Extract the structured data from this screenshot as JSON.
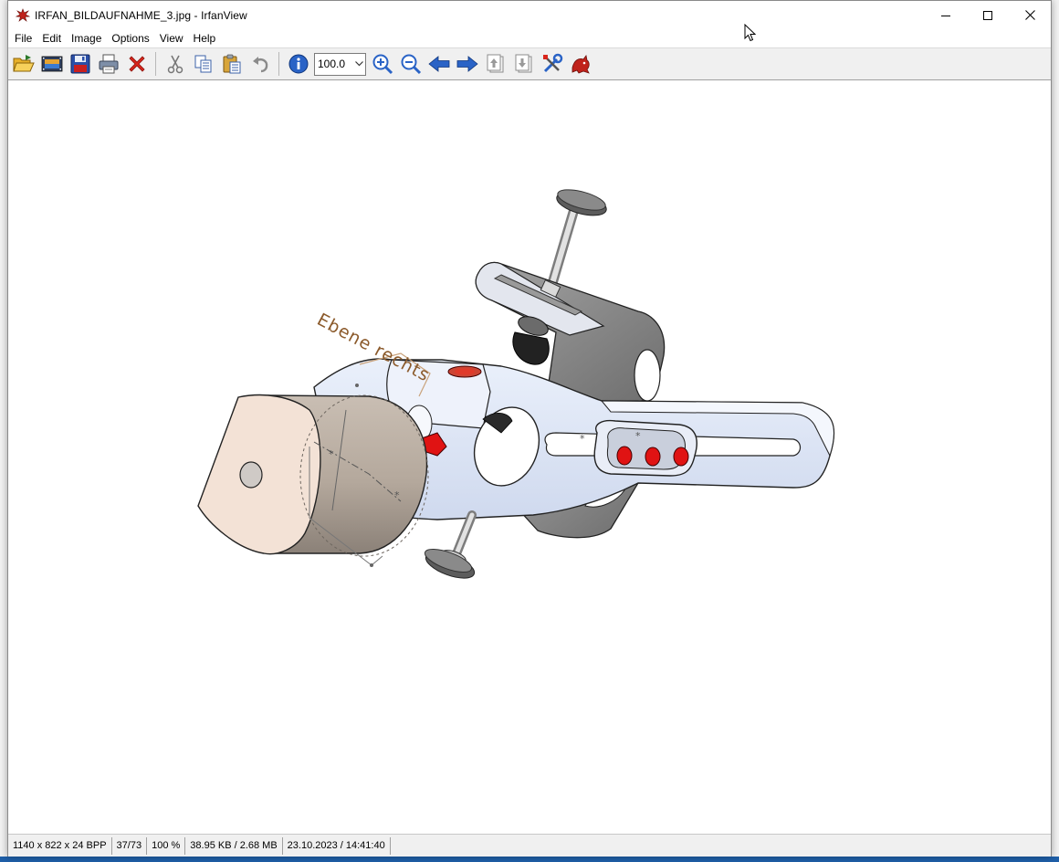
{
  "window": {
    "title": "IRFAN_BILDAUFNAHME_3.jpg - IrfanView"
  },
  "menu": [
    "File",
    "Edit",
    "Image",
    "Options",
    "View",
    "Help"
  ],
  "toolbar": {
    "zoom_value": "100.0"
  },
  "canvas": {
    "annotation_label": "Ebene rechts"
  },
  "statusbar": {
    "dimensions": "1140 x 822 x 24 BPP",
    "file_index": "37/73",
    "zoom": "100 %",
    "file_size": "38.95 KB / 2.68 MB",
    "datetime": "23.10.2023 / 14:41:40"
  },
  "colors": {
    "accent_blue": "#2a63c6",
    "delete_red": "#d9261c",
    "part_blue": "#dce4f5",
    "part_grey": "#8d8d8d",
    "cylinder_tan": "#c9bdb1",
    "label_brown": "#8b5a2b"
  }
}
